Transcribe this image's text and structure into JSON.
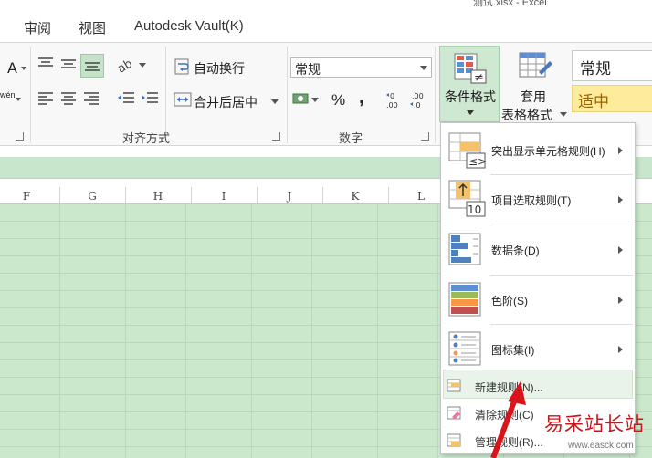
{
  "window": {
    "title": "测试.xlsx - Excel"
  },
  "menu_tabs": [
    "审阅",
    "视图",
    "Autodesk Vault(K)"
  ],
  "ribbon": {
    "alignment": {
      "wrap_text": "自动换行",
      "merge_center": "合并后居中",
      "group_label": "对齐方式"
    },
    "number": {
      "format_value": "常规",
      "percent": "%",
      "comma": ",",
      "group_label": "数字"
    },
    "conditional_format": {
      "label": "条件格式"
    },
    "table_format": {
      "label_line1": "套用",
      "label_line2": "表格格式"
    },
    "styles": {
      "normal": "常规",
      "neutral": "适中"
    },
    "font_glyphs": {
      "font_color": "A",
      "pinyin": "wén"
    }
  },
  "sheet": {
    "columns": [
      "F",
      "G",
      "H",
      "I",
      "J",
      "K",
      "L"
    ]
  },
  "cf_menu": {
    "items": [
      {
        "label": "突出显示单元格规则(H)",
        "icon": "highlight-cells-rules-icon"
      },
      {
        "label": "项目选取规则(T)",
        "icon": "top-bottom-rules-icon",
        "icon_text": "10"
      },
      {
        "label": "数据条(D)",
        "icon": "data-bars-icon"
      },
      {
        "label": "色阶(S)",
        "icon": "color-scales-icon"
      },
      {
        "label": "图标集(I)",
        "icon": "icon-sets-icon"
      }
    ],
    "small_items": [
      {
        "label": "新建规则(N)...",
        "icon": "new-rule-icon"
      },
      {
        "label": "清除规则(C)",
        "icon": "clear-rules-icon"
      },
      {
        "label": "管理规则(R)...",
        "icon": "manage-rules-icon"
      }
    ]
  },
  "watermark": {
    "text": "易采站长站",
    "url": "www.easck.com"
  },
  "colors": {
    "sheet_green": "#cbe8cd",
    "active_button": "#cfe8d1",
    "neutral_fill": "#ffeb9c",
    "arrow_red": "#d9141b"
  }
}
